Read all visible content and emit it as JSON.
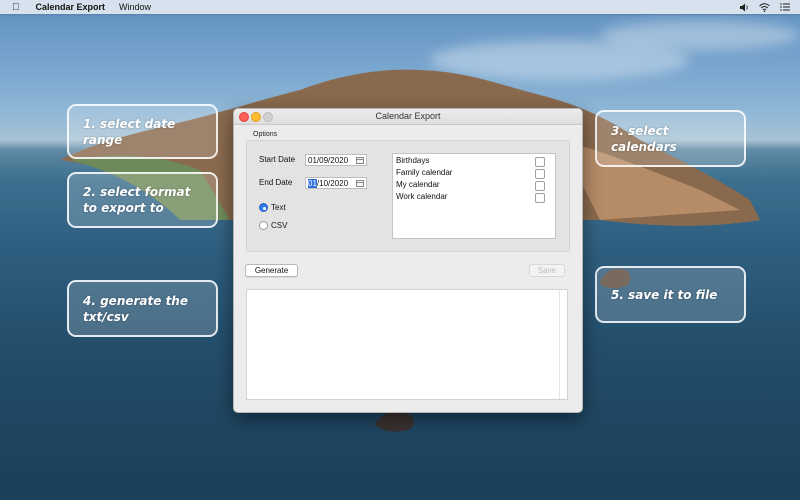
{
  "menubar": {
    "apple_icon": "apple-icon",
    "app_name": "Calendar Export",
    "items": [
      "Window"
    ],
    "status_icons": [
      "volume-icon",
      "wifi-icon",
      "list-icon"
    ]
  },
  "callouts": {
    "step1": "1. select date range",
    "step2": "2. select format\n to export to",
    "step3": "3. select calendars",
    "step4": "4. generate the\ntxt/csv",
    "step5": "5. save it to file"
  },
  "window": {
    "title": "Calendar Export",
    "options_label": "Options",
    "start_date_label": "Start Date",
    "start_date_value": "01/09/2020",
    "end_date_label": "End Date",
    "end_date_selected": "01",
    "end_date_rest": "/10/2020",
    "format_options": [
      {
        "label": "Text",
        "selected": true
      },
      {
        "label": "CSV",
        "selected": false
      }
    ],
    "calendars": [
      {
        "name": "Birthdays",
        "checked": false
      },
      {
        "name": "Family calendar",
        "checked": false
      },
      {
        "name": "My calendar",
        "checked": false
      },
      {
        "name": "Work calendar",
        "checked": false
      }
    ],
    "generate_label": "Generate",
    "save_label": "Save",
    "output_text": ""
  },
  "colors": {
    "accent": "#2f7ae5",
    "close": "#fe5f57",
    "minimize": "#febc2e"
  }
}
